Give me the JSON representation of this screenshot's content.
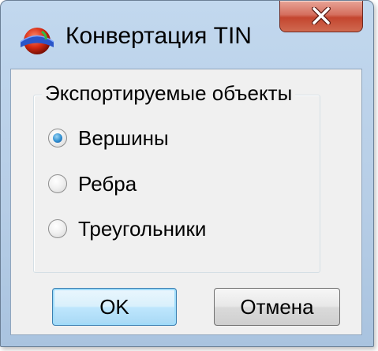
{
  "window": {
    "title": "Конвертация TIN"
  },
  "icons": {
    "app": "colored-sphere-icon",
    "close": "close-icon"
  },
  "group": {
    "label": "Экспортируемые объекты",
    "options": [
      {
        "label": "Вершины",
        "checked": true
      },
      {
        "label": "Ребра",
        "checked": false
      },
      {
        "label": "Треугольники",
        "checked": false
      }
    ]
  },
  "buttons": {
    "ok": "OK",
    "cancel": "Отмена"
  }
}
